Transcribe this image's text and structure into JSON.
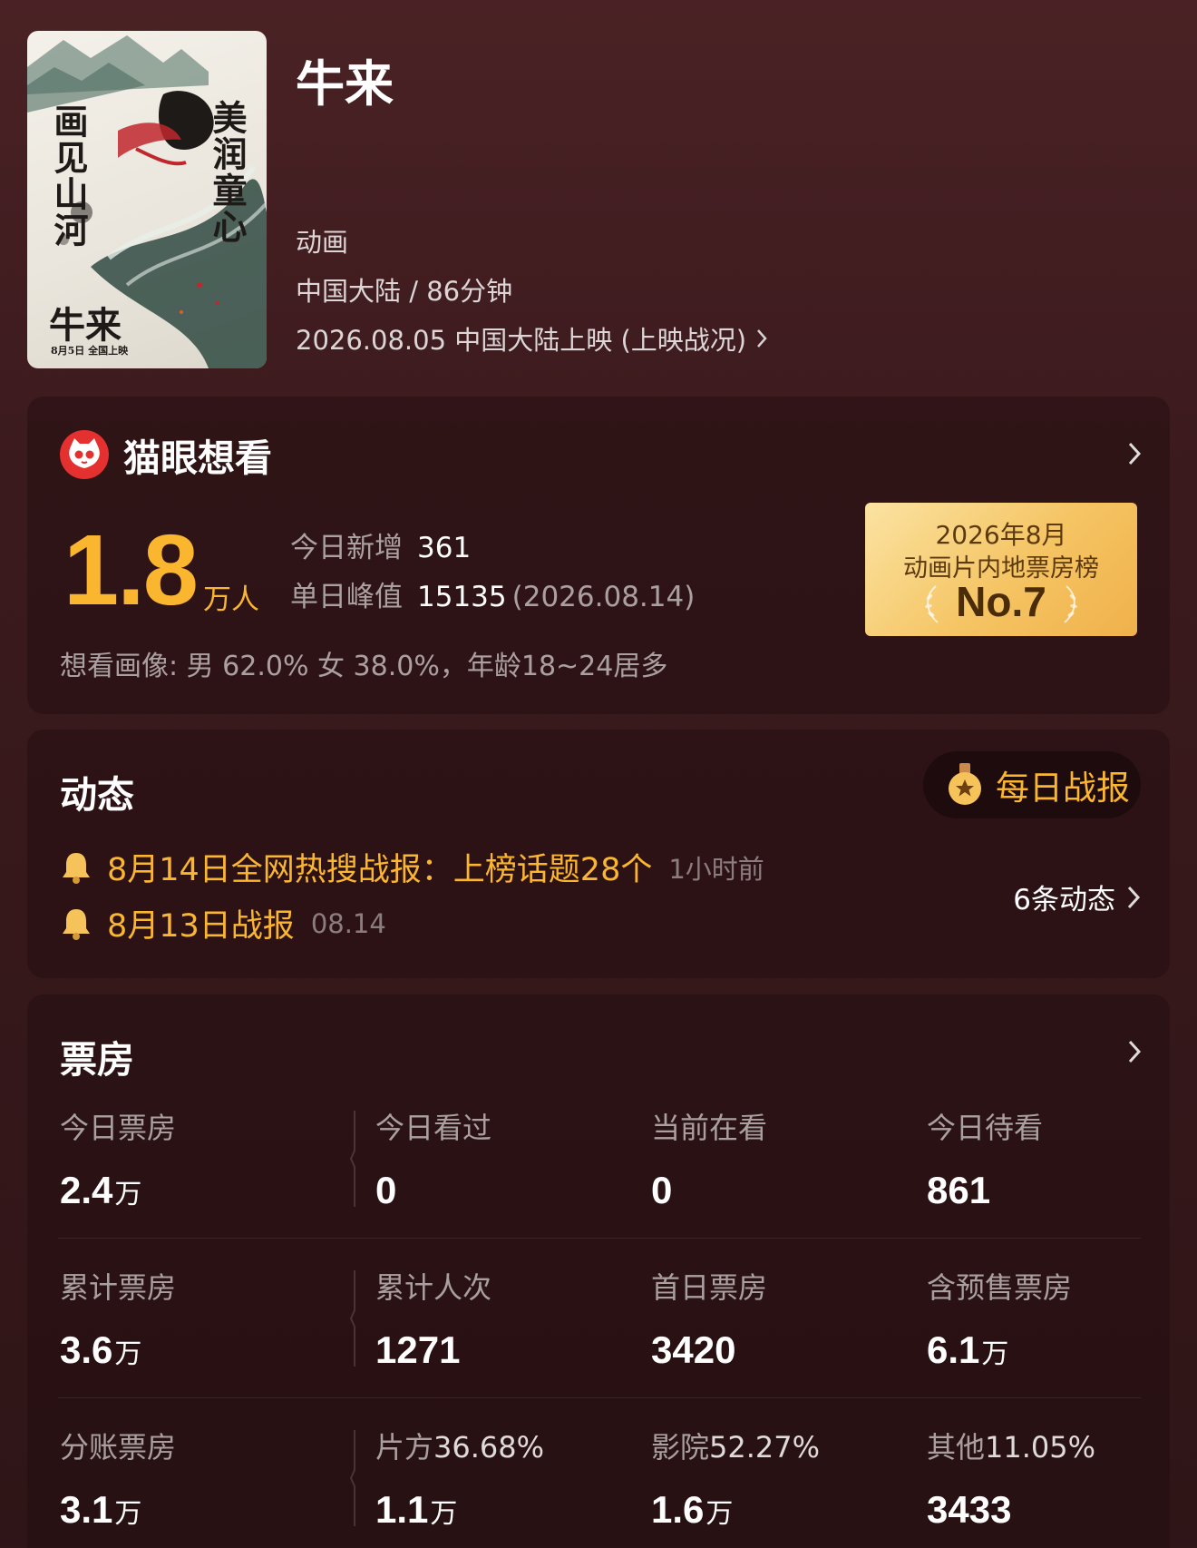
{
  "movie": {
    "title": "牛来",
    "genre": "动画",
    "region_duration": "中国大陆 / 86分钟",
    "release": "2026.08.05 中国大陆上映 (上映战况)",
    "poster": {
      "left_text": "画见山河",
      "right_text": "美润童心",
      "title": "牛来",
      "date": "8月5日 全国上映"
    }
  },
  "want": {
    "title": "猫眼想看",
    "big_value": "1.8",
    "big_unit": "万人",
    "today_label": "今日新增",
    "today_value": "361",
    "peak_label": "单日峰值",
    "peak_value": "15135",
    "peak_date": "(2026.08.14)",
    "portrait": "想看画像: 男 62.0%  女 38.0%，年龄18~24居多",
    "rank": {
      "line1": "2026年8月",
      "line2": "动画片内地票房榜",
      "no": "No.7"
    }
  },
  "news": {
    "title": "动态",
    "daily_button": "每日战报",
    "items": [
      {
        "text": "8月14日全网热搜战报：上榜话题28个",
        "time": "1小时前"
      },
      {
        "text": "8月13日战报",
        "time": "08.14"
      }
    ],
    "count": "6条动态"
  },
  "boxoffice": {
    "title": "票房",
    "rows": [
      [
        {
          "label": "今日票房",
          "value": "2.4",
          "unit": "万"
        },
        {
          "label": "今日看过",
          "value": "0",
          "unit": ""
        },
        {
          "label": "当前在看",
          "value": "0",
          "unit": ""
        },
        {
          "label": "今日待看",
          "value": "861",
          "unit": ""
        }
      ],
      [
        {
          "label": "累计票房",
          "value": "3.6",
          "unit": "万"
        },
        {
          "label": "累计人次",
          "value": "1271",
          "unit": ""
        },
        {
          "label": "首日票房",
          "value": "3420",
          "unit": ""
        },
        {
          "label": "含预售票房",
          "value": "6.1",
          "unit": "万"
        }
      ],
      [
        {
          "label": "分账票房",
          "label_pct": "",
          "value": "3.1",
          "unit": "万"
        },
        {
          "label": "片方",
          "label_pct": "36.68%",
          "value": "1.1",
          "unit": "万"
        },
        {
          "label": "影院",
          "label_pct": "52.27%",
          "value": "1.6",
          "unit": "万"
        },
        {
          "label": "其他",
          "label_pct": "11.05%",
          "value": "3433",
          "unit": ""
        }
      ]
    ]
  },
  "colors": {
    "accent": "#fbb630",
    "background": "#3b1a1d",
    "brand_red": "#e4312f",
    "badge_gold": "#f5c463"
  }
}
